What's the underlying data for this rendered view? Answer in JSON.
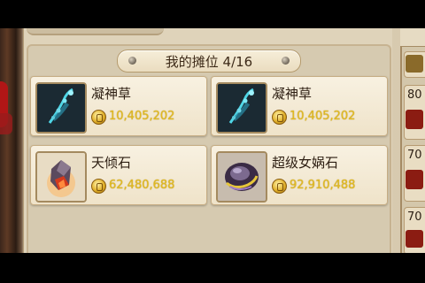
{
  "stall": {
    "title": "我的摊位 4/16",
    "items": [
      {
        "name": "凝神草",
        "price": "10,405,202",
        "icon": "blue-herb-icon"
      },
      {
        "name": "凝神草",
        "price": "10,405,202",
        "icon": "blue-herb-icon"
      },
      {
        "name": "天倾石",
        "price": "62,480,688",
        "icon": "red-crystal-icon"
      },
      {
        "name": "超级女娲石",
        "price": "92,910,488",
        "icon": "purple-nuwa-stone-icon"
      }
    ]
  },
  "right_list": {
    "visible_prefixes": [
      "80",
      "70",
      "70"
    ]
  },
  "colors": {
    "price_text": "#e3bb1f",
    "panel_bg": "#dfd3ba",
    "card_bg": "#f8f1e1"
  }
}
